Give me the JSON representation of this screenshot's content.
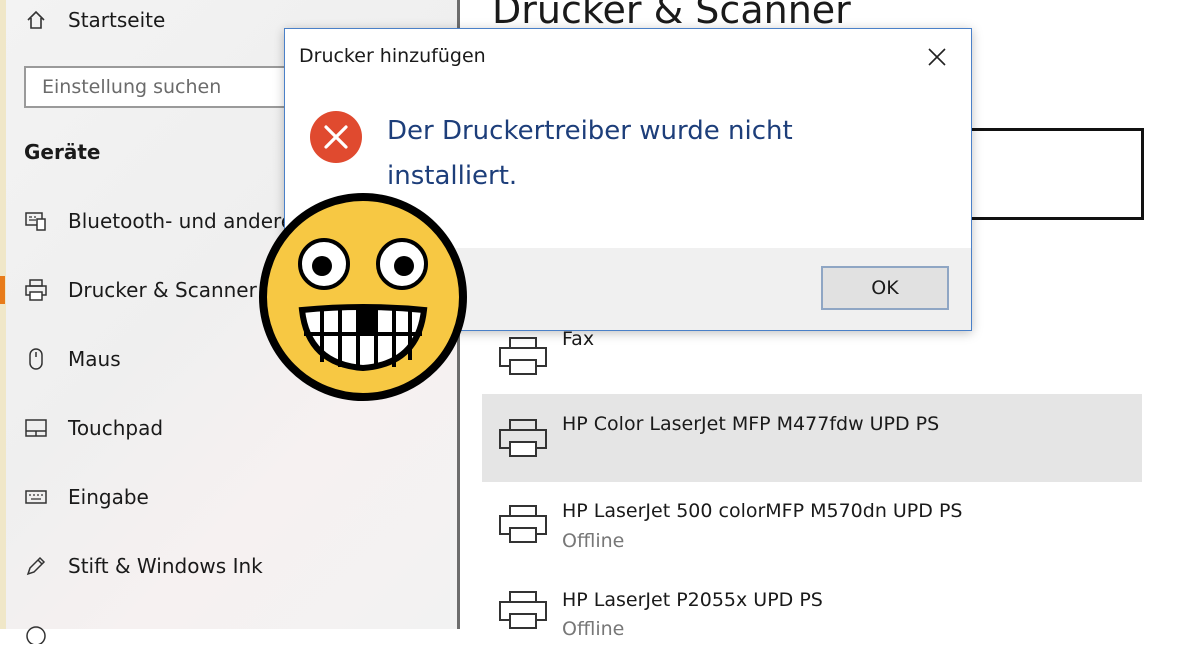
{
  "sidebar": {
    "home_label": "Startseite",
    "search_placeholder": "Einstellung suchen",
    "section_heading": "Geräte",
    "items": [
      {
        "label": "Bluetooth- und andere",
        "icon": "bluetooth-devices-icon"
      },
      {
        "label": "Drucker & Scanner",
        "icon": "printer-icon",
        "selected": true
      },
      {
        "label": "Maus",
        "icon": "mouse-icon"
      },
      {
        "label": "Touchpad",
        "icon": "touchpad-icon"
      },
      {
        "label": "Eingabe",
        "icon": "keyboard-icon"
      },
      {
        "label": "Stift & Windows Ink",
        "icon": "pen-icon"
      }
    ]
  },
  "main": {
    "title": "Drucker & Scanner",
    "printers": [
      {
        "name": "Fax",
        "status": ""
      },
      {
        "name": "HP Color LaserJet MFP M477fdw UPD PS",
        "status": "",
        "highlighted": true
      },
      {
        "name": "HP LaserJet 500 colorMFP M570dn UPD PS",
        "status": "Offline"
      },
      {
        "name": "HP LaserJet P2055x UPD PS",
        "status": "Offline"
      }
    ]
  },
  "dialog": {
    "title": "Drucker hinzufügen",
    "message": "Der Druckertreiber wurde nicht installiert.",
    "ok_label": "OK",
    "icon": "error-icon"
  },
  "overlay": {
    "icon": "grinning-emoji-icon"
  },
  "colors": {
    "accent": "#e87b1a",
    "error": "#e04a2f",
    "message_text": "#1d3e7a",
    "dialog_border": "#4a80c8"
  }
}
